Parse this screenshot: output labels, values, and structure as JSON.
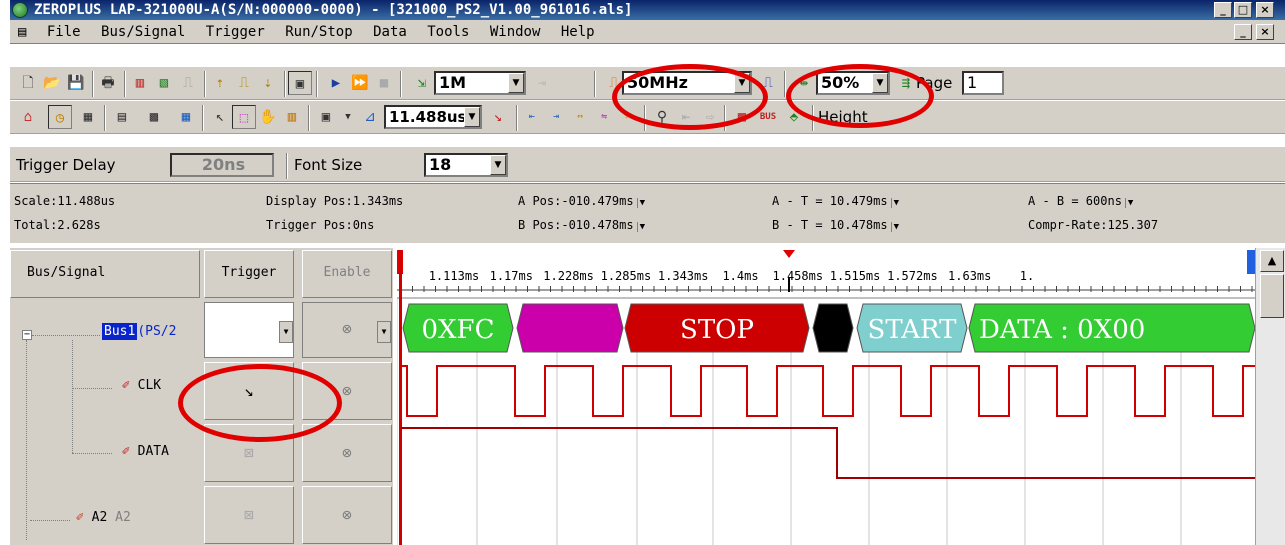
{
  "window": {
    "title": "ZEROPLUS LAP-321000U-A(S/N:000000-0000) - [321000_PS2_V1.00_961016.als]",
    "buttons": [
      "_",
      "□",
      "×"
    ]
  },
  "menu": {
    "items": [
      "File",
      "Bus/Signal",
      "Trigger",
      "Run/Stop",
      "Data",
      "Tools",
      "Window",
      "Help"
    ],
    "mdi_buttons": [
      "_",
      "▫",
      "×"
    ]
  },
  "toolbar1": {
    "memory_depth": "1M",
    "sample_rate": "50MHz",
    "zoom": "50%",
    "page_label": "Page",
    "page_value": "1"
  },
  "toolbar2": {
    "time_value": "11.488us",
    "height_label": "Height"
  },
  "toolbar3": {
    "trigger_delay_label": "Trigger Delay",
    "trigger_delay_value": "20ns",
    "font_size_label": "Font Size",
    "font_size_value": "18"
  },
  "info": {
    "scale": "Scale:11.488us",
    "total": "Total:2.628s",
    "display_pos": "Display Pos:1.343ms",
    "trigger_pos": "Trigger Pos:0ns",
    "a_pos": "A Pos:-010.479ms",
    "b_pos": "B Pos:-010.478ms",
    "a_t": "A - T = 10.479ms",
    "b_t": "B - T = 10.478ms",
    "a_b": "A - B = 600ns",
    "compr_rate": "Compr-Rate:125.307"
  },
  "columns": {
    "bus_signal": "Bus/Signal",
    "trigger": "Trigger",
    "enable": "Enable"
  },
  "signals": [
    {
      "name": "Bus1",
      "suffix": "(PS/2"
    },
    {
      "name": "CLK"
    },
    {
      "name": "DATA"
    },
    {
      "name": "A2",
      "suffix": "A2"
    }
  ],
  "timeline": {
    "ticks": [
      "1.113ms",
      "1.17ms",
      "1.228ms",
      "1.285ms",
      "1.343ms",
      "1.4ms",
      "1.458ms",
      "1.515ms",
      "1.572ms",
      "1.63ms",
      "1."
    ]
  },
  "bus_segments": [
    {
      "text": "0XFC",
      "color": "#33cc33"
    },
    {
      "text": "",
      "color": "#cc00aa"
    },
    {
      "text": "STOP",
      "color": "#cc0000"
    },
    {
      "text": "",
      "color": "#000000"
    },
    {
      "text": "START",
      "color": "#7fcfcf"
    },
    {
      "text": "DATA : 0X00",
      "color": "#33cc33"
    }
  ],
  "colors": {
    "annotation": "#e00000",
    "waveform": "#d00000",
    "data_line": "#a00000"
  }
}
